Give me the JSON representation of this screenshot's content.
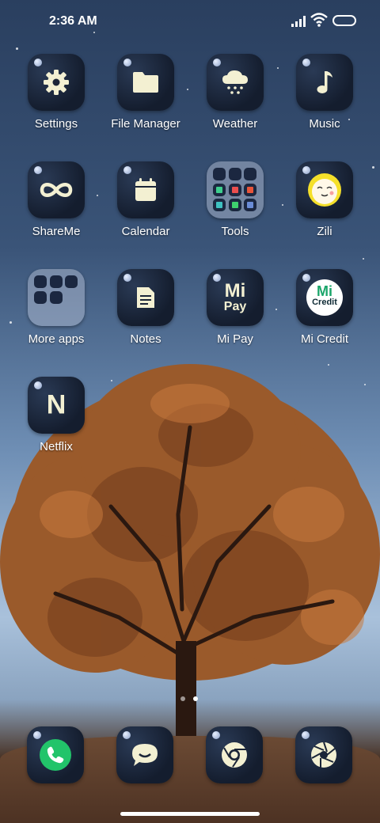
{
  "status_bar": {
    "time": "2:36 AM"
  },
  "apps": [
    {
      "label": "Settings",
      "icon": "gear-icon"
    },
    {
      "label": "File Manager",
      "icon": "folder-icon"
    },
    {
      "label": "Weather",
      "icon": "cloud-snow-icon"
    },
    {
      "label": "Music",
      "icon": "music-note-icon"
    },
    {
      "label": "ShareMe",
      "icon": "infinity-icon"
    },
    {
      "label": "Calendar",
      "icon": "calendar-icon"
    },
    {
      "label": "Tools",
      "icon": "folder-tools-icon"
    },
    {
      "label": "Zili",
      "icon": "zili-face-icon"
    },
    {
      "label": "More apps",
      "icon": "folder-more-apps-icon"
    },
    {
      "label": "Notes",
      "icon": "notes-icon"
    },
    {
      "label": "Mi Pay",
      "icon": "mi-pay-icon"
    },
    {
      "label": "Mi Credit",
      "icon": "mi-credit-icon"
    },
    {
      "label": "Netflix",
      "icon": "netflix-icon"
    }
  ],
  "icon_text": {
    "netflix_letter": "N",
    "mipay_top": "Mi",
    "mipay_bottom": "Pay",
    "micredit_top": "Mi",
    "micredit_bottom": "Credit"
  },
  "dock": [
    {
      "icon": "phone-icon"
    },
    {
      "icon": "messages-icon"
    },
    {
      "icon": "browser-icon"
    },
    {
      "icon": "camera-icon"
    }
  ],
  "colors": {
    "accent_green": "#22c46a",
    "icon_cream": "#f3f0d2"
  }
}
